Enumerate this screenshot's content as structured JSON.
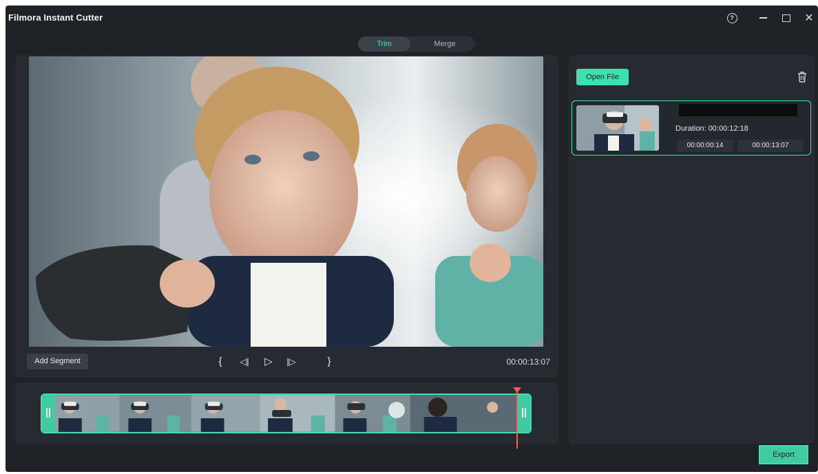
{
  "window": {
    "title": "Filmora Instant Cutter"
  },
  "tabs": [
    {
      "label": "Trim",
      "active": true
    },
    {
      "label": "Merge",
      "active": false
    }
  ],
  "preview": {
    "add_segment_label": "Add Segment",
    "controls": {
      "mark_in": "{",
      "prev_frame": "◁|",
      "play": "▷",
      "next_frame": "|▷",
      "mark_out": "}"
    },
    "timecode": "00:00:13:07"
  },
  "timeline": {
    "playhead_progress": 0.97
  },
  "library": {
    "open_file_label": "Open File",
    "clips": [
      {
        "duration": "Duration: 00:00:12:18",
        "in_time": "00:00:00:14",
        "out_time": "00:00:13:07"
      }
    ]
  },
  "export_label": "Export",
  "colors": {
    "accent": "#3fe0b0",
    "background": "#1f2328",
    "panel": "#262b31",
    "playhead": "#ff5a5a"
  },
  "icons": [
    "help-icon",
    "minimize-icon",
    "maximize-icon",
    "close-icon",
    "trash-icon",
    "play-icon",
    "prev-frame-icon",
    "next-frame-icon",
    "mark-in-icon",
    "mark-out-icon"
  ]
}
